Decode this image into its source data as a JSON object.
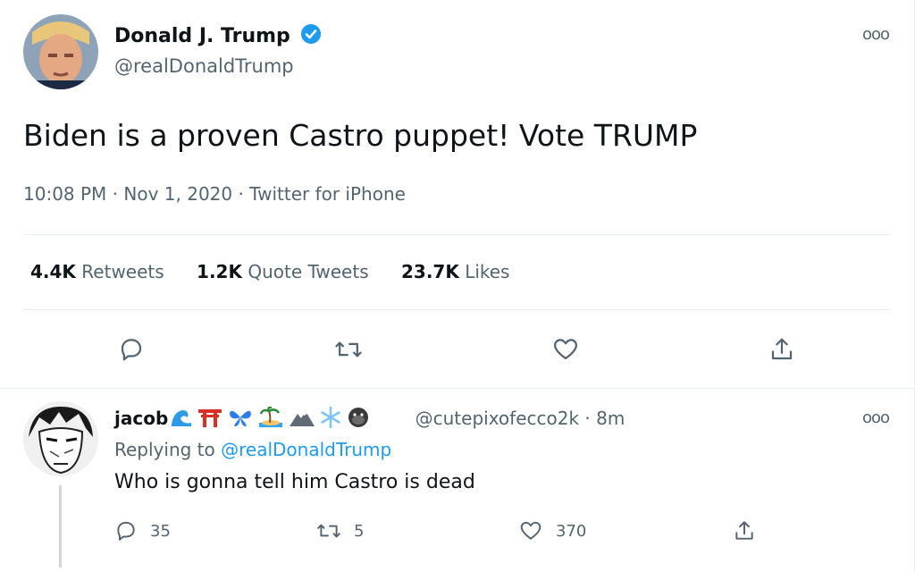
{
  "tweet": {
    "author_name": "Donald J. Trump",
    "author_handle": "@realDonaldTrump",
    "text": "Biden is a proven Castro puppet! Vote TRUMP",
    "timestamp": "10:08 PM · Nov 1, 2020 · Twitter for iPhone",
    "stats": {
      "retweets_count": "4.4K",
      "retweets_label": "Retweets",
      "quotes_count": "1.2K",
      "quotes_label": "Quote Tweets",
      "likes_count": "23.7K",
      "likes_label": "Likes"
    },
    "more_icon": "more-icon"
  },
  "reply": {
    "author_name": "jacob",
    "emojis": "🌊⛩🦋🏝🏔❄🦍",
    "author_handle": "@cutepixofecco2k",
    "time": "· 8m",
    "replying_label": "Replying to",
    "replying_to": "@realDonaldTrump",
    "text": "Who is gonna tell him Castro is dead",
    "reply_count": "35",
    "retweet_count": "5",
    "like_count": "370"
  },
  "colors": {
    "accent": "#1d9bf0",
    "secondary_text": "#536471",
    "divider": "#e6ecf0"
  }
}
